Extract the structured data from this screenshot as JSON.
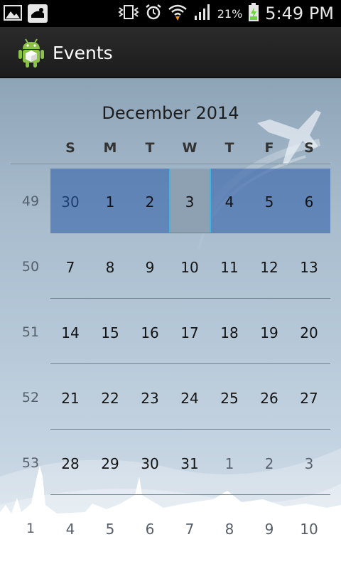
{
  "status_bar": {
    "battery_percent": "21%",
    "time": "5:49 PM",
    "icons": [
      "gallery-icon",
      "app-notification-icon",
      "vibrate-icon",
      "alarm-icon",
      "wifi-icon",
      "signal-icon",
      "battery-charging-icon"
    ]
  },
  "action_bar": {
    "title": "Events",
    "icon": "android-app-icon"
  },
  "calendar": {
    "month_title": "December 2014",
    "weekday_headers": [
      "S",
      "M",
      "T",
      "W",
      "T",
      "F",
      "S"
    ],
    "selected_week": 49,
    "accent_color": "#39b6e6",
    "selection_color": "#3764aa",
    "weeks": [
      {
        "number": "49",
        "days": [
          "30",
          "1",
          "2",
          "3",
          "4",
          "5",
          "6"
        ]
      },
      {
        "number": "50",
        "days": [
          "7",
          "8",
          "9",
          "10",
          "11",
          "12",
          "13"
        ]
      },
      {
        "number": "51",
        "days": [
          "14",
          "15",
          "16",
          "17",
          "18",
          "19",
          "20"
        ]
      },
      {
        "number": "52",
        "days": [
          "21",
          "22",
          "23",
          "24",
          "25",
          "26",
          "27"
        ]
      },
      {
        "number": "53",
        "days": [
          "28",
          "29",
          "30",
          "31",
          "1",
          "2",
          "3"
        ]
      },
      {
        "number": "1",
        "days": [
          "4",
          "5",
          "6",
          "7",
          "8",
          "9",
          "10"
        ]
      }
    ]
  }
}
